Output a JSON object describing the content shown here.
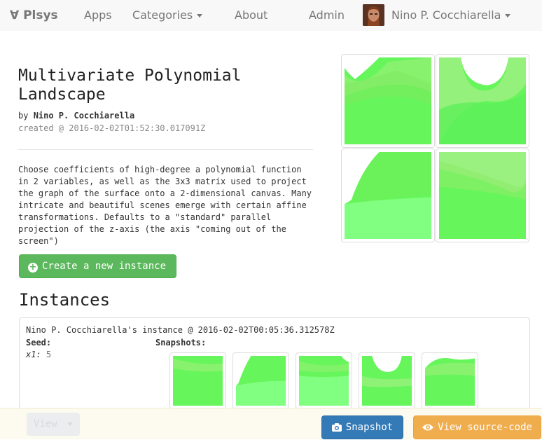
{
  "nav": {
    "brand": "∀ Plsys",
    "apps": "Apps",
    "categories": "Categories",
    "about": "About",
    "admin": "Admin",
    "user_name": "Nino P. Cocchiarella"
  },
  "app": {
    "title": "Multivariate Polynomial Landscape",
    "by_prefix": "by",
    "author": "Nino P. Cocchiarella",
    "created": "created @ 2016-02-02T01:52:30.017091Z",
    "description": "Choose coefficients of high-degree a polynomial function in 2 variables, as well as the 3x3 matrix used to project the graph of the surface onto a 2-dimensional canvas. Many intricate and beautiful scenes emerge with certain affine transformations. Defaults to a \"standard\" parallel projection of the z-axis (the axis \"coming out of the screen\")",
    "create_button": "Create a new instance"
  },
  "instances": {
    "heading": "Instances",
    "items": [
      {
        "title": "Nino P. Cocchiarella's instance @ 2016-02-02T00:05:36.312578Z",
        "seed_label": "Seed:",
        "snapshots_label": "Snapshots:",
        "seed_var": "x1:",
        "seed_value": "5"
      }
    ]
  },
  "footer": {
    "view_button": "View",
    "snapshot_button": "Snapshot",
    "source_button": "View source-code"
  },
  "colors": {
    "accent_green": "#5cb85c",
    "primary_blue": "#337ab7",
    "warning_orange": "#f0ad4e",
    "surface_green": "#66f55a",
    "surface_light": "#80ff80"
  }
}
